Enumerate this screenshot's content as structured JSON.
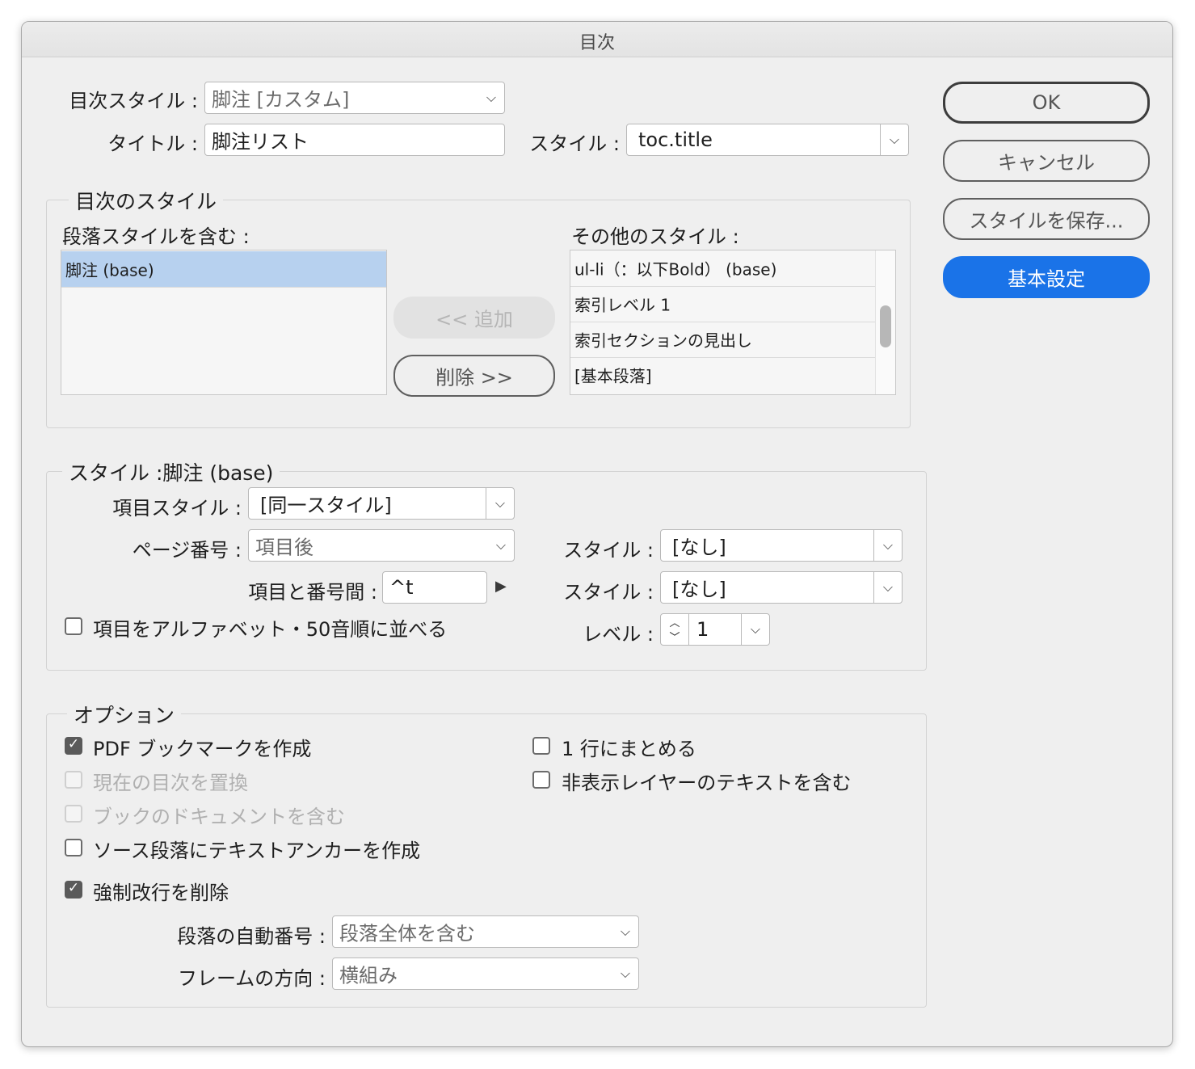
{
  "window": {
    "title": "目次"
  },
  "top": {
    "toc_style_label": "目次スタイル :",
    "toc_style_value": "脚注 [カスタム]",
    "title_label": "タイトル :",
    "title_value": "脚注リスト",
    "style_label": "スタイル :",
    "style_value": "toc.title"
  },
  "buttons": {
    "ok": "OK",
    "cancel": "キャンセル",
    "save_style": "スタイルを保存...",
    "basic": "基本設定"
  },
  "toc_styles": {
    "group_title": "目次のスタイル",
    "include_label": "段落スタイルを含む :",
    "include_items": [
      "脚注 (base)"
    ],
    "other_label": "その他のスタイル :",
    "other_items": [
      "ul-li（：以下Bold） (base)",
      "索引レベル 1",
      "索引セクションの見出し",
      "[基本段落]"
    ],
    "add_button": "<< 追加",
    "remove_button": "削除 >>"
  },
  "style_section": {
    "group_title": "スタイル :脚注 (base)",
    "entry_style_label": "項目スタイル :",
    "entry_style_value": "[同一スタイル]",
    "page_number_label": "ページ番号 :",
    "page_number_value": "項目後",
    "page_style_label": "スタイル :",
    "page_style_value": "[なし]",
    "between_label": "項目と番号間 :",
    "between_value": "^t",
    "between_style_label": "スタイル :",
    "between_style_value": "[なし]",
    "alpha_sort_label": "項目をアルファベット・50音順に並べる",
    "alpha_sort_checked": false,
    "level_label": "レベル :",
    "level_value": "1"
  },
  "options": {
    "group_title": "オプション",
    "pdf_bookmark": "PDF ブックマークを作成",
    "replace_toc": "現在の目次を置換",
    "include_book": "ブックのドキュメントを含む",
    "text_anchor": "ソース段落にテキストアンカーを作成",
    "remove_breaks": "強制改行を削除",
    "run_in": "1 行にまとめる",
    "hidden_layers": "非表示レイヤーのテキストを含む",
    "numbered_label": "段落の自動番号 :",
    "numbered_value": "段落全体を含む",
    "frame_dir_label": "フレームの方向 :",
    "frame_dir_value": "横組み"
  }
}
